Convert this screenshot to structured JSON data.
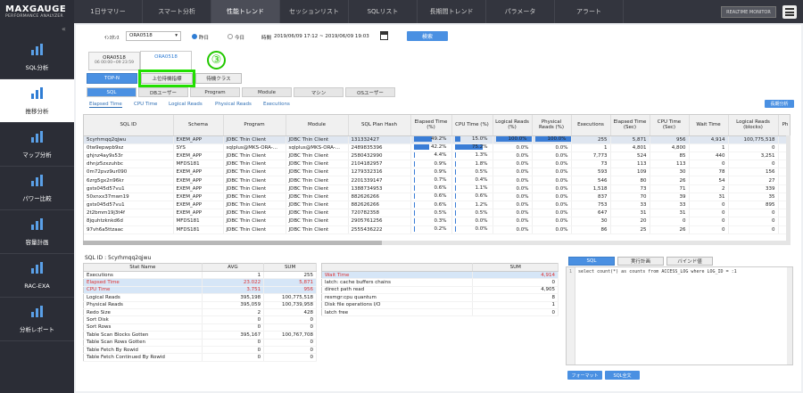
{
  "brand": {
    "name": "MAXGAUGE",
    "tagline": "PERFORMANCE ANALYZER"
  },
  "topnav": [
    "1日サマリー",
    "スマート分析",
    "性能トレンド",
    "セッションリスト",
    "SQLリスト",
    "長期間トレンド",
    "パラメータ",
    "アラート"
  ],
  "topnav_active": 2,
  "realtime_monitor": "REALTIME MONITOR",
  "sidebar": [
    "SQL分析",
    "推移分析",
    "マップ分析",
    "パワー比較",
    "容量計画",
    "RAC-EXA",
    "分析レポート"
  ],
  "sidebar_active": 1,
  "filter": {
    "instance_label": "ｲﾝｽﾀﾝｽ",
    "instance_value": "ORA0518",
    "yesterday": "昨日",
    "today": "今日",
    "time_label": "時間",
    "time_range": "2019/06/09 17:12 ~ 2019/06/09 19:03",
    "search": "検索"
  },
  "instance_tabs": [
    {
      "name": "ORA0518",
      "time": "06 00:00~09 23:59"
    },
    {
      "name": "ORA0518",
      "time": ""
    }
  ],
  "subtabs": [
    "TOP-N",
    "上位待機指標",
    "待機クラス"
  ],
  "chips": [
    "SQL",
    "DBユーザー",
    "Program",
    "Module",
    "マシン",
    "OSユーザー"
  ],
  "long_term_btn": "長期分析",
  "metric_tabs": [
    "Elapsed Time",
    "CPU Time",
    "Logical Reads",
    "Physical Reads",
    "Executions"
  ],
  "grid": {
    "headers": [
      "SQL ID",
      "Schema",
      "Program",
      "Module",
      "SQL Plan Hash",
      "Elapsed Time (%)",
      "CPU Time (%)",
      "Logical Reads (%)",
      "Physical Reads (%)",
      "Executions",
      "Elapsed Time (Sec)",
      "CPU Time (Sec)",
      "Wait Time",
      "Logical Reads (blocks)",
      "Ph"
    ],
    "rows": [
      [
        "5cyrhmqq2qjwu",
        "EXEM_APP",
        "JDBC Thin Client",
        "JDBC Thin Client",
        "131332427",
        "49.2%",
        "15.0%",
        "100.0%",
        "100.0%",
        "255",
        "5,871",
        "956",
        "4,914",
        "100,775,518"
      ],
      [
        "0tw9epwpb9sz",
        "SYS",
        "sqlplus@MKS-ORA-...",
        "sqlplus@MKS-ORA-...",
        "2489835396",
        "42.2%",
        "75.2%",
        "0.0%",
        "0.0%",
        "1",
        "4,801",
        "4,800",
        "1",
        "0"
      ],
      [
        "ghjnz4ay9s53r",
        "EXEM_APP",
        "JDBC Thin Client",
        "JDBC Thin Client",
        "2580432990",
        "4.4%",
        "1.3%",
        "0.0%",
        "0.0%",
        "7,773",
        "524",
        "85",
        "440",
        "3,251"
      ],
      [
        "dhnjz5zxzuhbc",
        "MFDS181",
        "JDBC Thin Client",
        "JDBC Thin Client",
        "2104182957",
        "0.9%",
        "1.8%",
        "0.0%",
        "0.0%",
        "73",
        "113",
        "113",
        "0",
        "0"
      ],
      [
        "0m72pvz9ur090",
        "EXEM_APP",
        "JDBC Thin Client",
        "JDBC Thin Client",
        "1279332316",
        "0.9%",
        "0.5%",
        "0.0%",
        "0.0%",
        "593",
        "109",
        "30",
        "78",
        "156"
      ],
      [
        "6zrg5gx2n96kr",
        "EXEM_APP",
        "JDBC Thin Client",
        "JDBC Thin Client",
        "2201339147",
        "0.7%",
        "0.4%",
        "0.0%",
        "0.0%",
        "546",
        "80",
        "26",
        "54",
        "27"
      ],
      [
        "gsts045d57vu1",
        "EXEM_APP",
        "JDBC Thin Client",
        "JDBC Thin Client",
        "1388734953",
        "0.6%",
        "1.1%",
        "0.0%",
        "0.0%",
        "1,518",
        "73",
        "71",
        "2",
        "339"
      ],
      [
        "50xnxx37mwn19",
        "EXEM_APP",
        "JDBC Thin Client",
        "JDBC Thin Client",
        "882626266",
        "0.6%",
        "0.6%",
        "0.0%",
        "0.0%",
        "837",
        "70",
        "39",
        "31",
        "35"
      ],
      [
        "gsts045d57vu1",
        "EXEM_APP",
        "JDBC Thin Client",
        "JDBC Thin Client",
        "882626266",
        "0.6%",
        "1.2%",
        "0.0%",
        "0.0%",
        "753",
        "33",
        "33",
        "0",
        "895"
      ],
      [
        "2t2bmm19j3t4f",
        "EXEM_APP",
        "JDBC Thin Client",
        "JDBC Thin Client",
        "720782358",
        "0.5%",
        "0.5%",
        "0.0%",
        "0.0%",
        "647",
        "31",
        "31",
        "0",
        "0"
      ],
      [
        "8jquhtzknkd6d",
        "MFDS181",
        "JDBC Thin Client",
        "JDBC Thin Client",
        "2905761256",
        "0.3%",
        "0.0%",
        "0.0%",
        "0.0%",
        "30",
        "20",
        "0",
        "0",
        "0"
      ],
      [
        "97vh6a5ttzaac",
        "MFDS181",
        "JDBC Thin Client",
        "JDBC Thin Client",
        "2555436222",
        "0.2%",
        "0.0%",
        "0.0%",
        "0.0%",
        "86",
        "25",
        "26",
        "0",
        "0"
      ]
    ],
    "elapsed_bar": [
      49.2,
      42.2,
      4.4,
      0.9,
      0.9,
      0.7,
      0.6,
      0.6,
      0.6,
      0.5,
      0.3,
      0.2
    ],
    "cpu_bar": [
      15.0,
      75.2,
      1.3,
      1.8,
      0.5,
      0.4,
      1.1,
      0.6,
      1.2,
      0.5,
      0,
      0
    ]
  },
  "sqlid_label": "SQL ID : 5cyrhmqq2qjwu",
  "stat_table": {
    "headers": [
      "Stat Name",
      "AVG",
      "SUM"
    ],
    "rows": [
      [
        "Executions",
        "1",
        "255"
      ],
      [
        "Elapsed Time",
        "23.022",
        "5,871"
      ],
      [
        "CPU Time",
        "3.751",
        "956"
      ],
      [
        "Logical Reads",
        "395,198",
        "100,775,518"
      ],
      [
        "Physical Reads",
        "395,059",
        "100,739,958"
      ],
      [
        "Redo Size",
        "2",
        "428"
      ],
      [
        "Sort Disk",
        "0",
        "0"
      ],
      [
        "Sort Rows",
        "0",
        "0"
      ],
      [
        "Table Scan Blocks Gotten",
        "395,167",
        "100,767,708"
      ],
      [
        "Table Scan Rows Gotten",
        "0",
        "0"
      ],
      [
        "Table Fetch By Rowid",
        "0",
        "0"
      ],
      [
        "Table Fetch Continued By Rowid",
        "0",
        "0"
      ]
    ]
  },
  "wait_table": {
    "headers": [
      "",
      "SUM"
    ],
    "rows": [
      [
        "Wait Time",
        "4,914"
      ],
      [
        "latch: cache buffers chains",
        "0"
      ],
      [
        "direct path read",
        "4,905"
      ],
      [
        "resmgr:cpu quantum",
        "8"
      ],
      [
        "Disk file operations I/O",
        "1"
      ],
      [
        "latch free",
        "0"
      ]
    ]
  },
  "sql_tabs": [
    "SQL",
    "実行計画",
    "バインド値"
  ],
  "sql_text": "select count(*) as counts from ACCESS_LOG where LOG_ID = :1",
  "sql_line": "1",
  "sql_buttons": [
    "フォーマット",
    "SQL全文"
  ],
  "annotation": "③",
  "colors": {
    "accent": "#4a90e2",
    "highlight": "#22e000",
    "dark": "#2b2d36"
  }
}
